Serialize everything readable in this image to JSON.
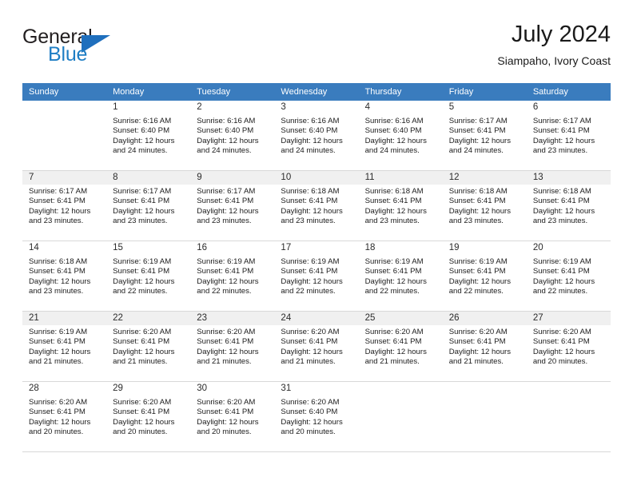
{
  "brand": {
    "name_part1": "General",
    "name_part2": "Blue",
    "flag_icon": "triangle-flag-icon"
  },
  "header": {
    "title": "July 2024",
    "subtitle": "Siampaho, Ivory Coast"
  },
  "colors": {
    "header_row_bg": "#3a7cbe",
    "brand_blue": "#1f7ec4",
    "daynum_bg": "#f2f2f2",
    "grid_line": "#d8d8d8"
  },
  "weekdays": [
    "Sunday",
    "Monday",
    "Tuesday",
    "Wednesday",
    "Thursday",
    "Friday",
    "Saturday"
  ],
  "labels": {
    "sunrise_prefix": "Sunrise:",
    "sunset_prefix": "Sunset:",
    "daylight_prefix": "Daylight:"
  },
  "weeks": [
    {
      "shaded": false,
      "days": [
        {
          "empty": true
        },
        {
          "day": "1",
          "sunrise": "Sunrise: 6:16 AM",
          "sunset": "Sunset: 6:40 PM",
          "daylight_l1": "Daylight: 12 hours",
          "daylight_l2": "and 24 minutes."
        },
        {
          "day": "2",
          "sunrise": "Sunrise: 6:16 AM",
          "sunset": "Sunset: 6:40 PM",
          "daylight_l1": "Daylight: 12 hours",
          "daylight_l2": "and 24 minutes."
        },
        {
          "day": "3",
          "sunrise": "Sunrise: 6:16 AM",
          "sunset": "Sunset: 6:40 PM",
          "daylight_l1": "Daylight: 12 hours",
          "daylight_l2": "and 24 minutes."
        },
        {
          "day": "4",
          "sunrise": "Sunrise: 6:16 AM",
          "sunset": "Sunset: 6:40 PM",
          "daylight_l1": "Daylight: 12 hours",
          "daylight_l2": "and 24 minutes."
        },
        {
          "day": "5",
          "sunrise": "Sunrise: 6:17 AM",
          "sunset": "Sunset: 6:41 PM",
          "daylight_l1": "Daylight: 12 hours",
          "daylight_l2": "and 24 minutes."
        },
        {
          "day": "6",
          "sunrise": "Sunrise: 6:17 AM",
          "sunset": "Sunset: 6:41 PM",
          "daylight_l1": "Daylight: 12 hours",
          "daylight_l2": "and 23 minutes."
        }
      ]
    },
    {
      "shaded": true,
      "days": [
        {
          "day": "7",
          "sunrise": "Sunrise: 6:17 AM",
          "sunset": "Sunset: 6:41 PM",
          "daylight_l1": "Daylight: 12 hours",
          "daylight_l2": "and 23 minutes."
        },
        {
          "day": "8",
          "sunrise": "Sunrise: 6:17 AM",
          "sunset": "Sunset: 6:41 PM",
          "daylight_l1": "Daylight: 12 hours",
          "daylight_l2": "and 23 minutes."
        },
        {
          "day": "9",
          "sunrise": "Sunrise: 6:17 AM",
          "sunset": "Sunset: 6:41 PM",
          "daylight_l1": "Daylight: 12 hours",
          "daylight_l2": "and 23 minutes."
        },
        {
          "day": "10",
          "sunrise": "Sunrise: 6:18 AM",
          "sunset": "Sunset: 6:41 PM",
          "daylight_l1": "Daylight: 12 hours",
          "daylight_l2": "and 23 minutes."
        },
        {
          "day": "11",
          "sunrise": "Sunrise: 6:18 AM",
          "sunset": "Sunset: 6:41 PM",
          "daylight_l1": "Daylight: 12 hours",
          "daylight_l2": "and 23 minutes."
        },
        {
          "day": "12",
          "sunrise": "Sunrise: 6:18 AM",
          "sunset": "Sunset: 6:41 PM",
          "daylight_l1": "Daylight: 12 hours",
          "daylight_l2": "and 23 minutes."
        },
        {
          "day": "13",
          "sunrise": "Sunrise: 6:18 AM",
          "sunset": "Sunset: 6:41 PM",
          "daylight_l1": "Daylight: 12 hours",
          "daylight_l2": "and 23 minutes."
        }
      ]
    },
    {
      "shaded": false,
      "days": [
        {
          "day": "14",
          "sunrise": "Sunrise: 6:18 AM",
          "sunset": "Sunset: 6:41 PM",
          "daylight_l1": "Daylight: 12 hours",
          "daylight_l2": "and 23 minutes."
        },
        {
          "day": "15",
          "sunrise": "Sunrise: 6:19 AM",
          "sunset": "Sunset: 6:41 PM",
          "daylight_l1": "Daylight: 12 hours",
          "daylight_l2": "and 22 minutes."
        },
        {
          "day": "16",
          "sunrise": "Sunrise: 6:19 AM",
          "sunset": "Sunset: 6:41 PM",
          "daylight_l1": "Daylight: 12 hours",
          "daylight_l2": "and 22 minutes."
        },
        {
          "day": "17",
          "sunrise": "Sunrise: 6:19 AM",
          "sunset": "Sunset: 6:41 PM",
          "daylight_l1": "Daylight: 12 hours",
          "daylight_l2": "and 22 minutes."
        },
        {
          "day": "18",
          "sunrise": "Sunrise: 6:19 AM",
          "sunset": "Sunset: 6:41 PM",
          "daylight_l1": "Daylight: 12 hours",
          "daylight_l2": "and 22 minutes."
        },
        {
          "day": "19",
          "sunrise": "Sunrise: 6:19 AM",
          "sunset": "Sunset: 6:41 PM",
          "daylight_l1": "Daylight: 12 hours",
          "daylight_l2": "and 22 minutes."
        },
        {
          "day": "20",
          "sunrise": "Sunrise: 6:19 AM",
          "sunset": "Sunset: 6:41 PM",
          "daylight_l1": "Daylight: 12 hours",
          "daylight_l2": "and 22 minutes."
        }
      ]
    },
    {
      "shaded": true,
      "days": [
        {
          "day": "21",
          "sunrise": "Sunrise: 6:19 AM",
          "sunset": "Sunset: 6:41 PM",
          "daylight_l1": "Daylight: 12 hours",
          "daylight_l2": "and 21 minutes."
        },
        {
          "day": "22",
          "sunrise": "Sunrise: 6:20 AM",
          "sunset": "Sunset: 6:41 PM",
          "daylight_l1": "Daylight: 12 hours",
          "daylight_l2": "and 21 minutes."
        },
        {
          "day": "23",
          "sunrise": "Sunrise: 6:20 AM",
          "sunset": "Sunset: 6:41 PM",
          "daylight_l1": "Daylight: 12 hours",
          "daylight_l2": "and 21 minutes."
        },
        {
          "day": "24",
          "sunrise": "Sunrise: 6:20 AM",
          "sunset": "Sunset: 6:41 PM",
          "daylight_l1": "Daylight: 12 hours",
          "daylight_l2": "and 21 minutes."
        },
        {
          "day": "25",
          "sunrise": "Sunrise: 6:20 AM",
          "sunset": "Sunset: 6:41 PM",
          "daylight_l1": "Daylight: 12 hours",
          "daylight_l2": "and 21 minutes."
        },
        {
          "day": "26",
          "sunrise": "Sunrise: 6:20 AM",
          "sunset": "Sunset: 6:41 PM",
          "daylight_l1": "Daylight: 12 hours",
          "daylight_l2": "and 21 minutes."
        },
        {
          "day": "27",
          "sunrise": "Sunrise: 6:20 AM",
          "sunset": "Sunset: 6:41 PM",
          "daylight_l1": "Daylight: 12 hours",
          "daylight_l2": "and 20 minutes."
        }
      ]
    },
    {
      "shaded": false,
      "days": [
        {
          "day": "28",
          "sunrise": "Sunrise: 6:20 AM",
          "sunset": "Sunset: 6:41 PM",
          "daylight_l1": "Daylight: 12 hours",
          "daylight_l2": "and 20 minutes."
        },
        {
          "day": "29",
          "sunrise": "Sunrise: 6:20 AM",
          "sunset": "Sunset: 6:41 PM",
          "daylight_l1": "Daylight: 12 hours",
          "daylight_l2": "and 20 minutes."
        },
        {
          "day": "30",
          "sunrise": "Sunrise: 6:20 AM",
          "sunset": "Sunset: 6:41 PM",
          "daylight_l1": "Daylight: 12 hours",
          "daylight_l2": "and 20 minutes."
        },
        {
          "day": "31",
          "sunrise": "Sunrise: 6:20 AM",
          "sunset": "Sunset: 6:40 PM",
          "daylight_l1": "Daylight: 12 hours",
          "daylight_l2": "and 20 minutes."
        },
        {
          "empty": true
        },
        {
          "empty": true
        },
        {
          "empty": true
        }
      ]
    }
  ]
}
